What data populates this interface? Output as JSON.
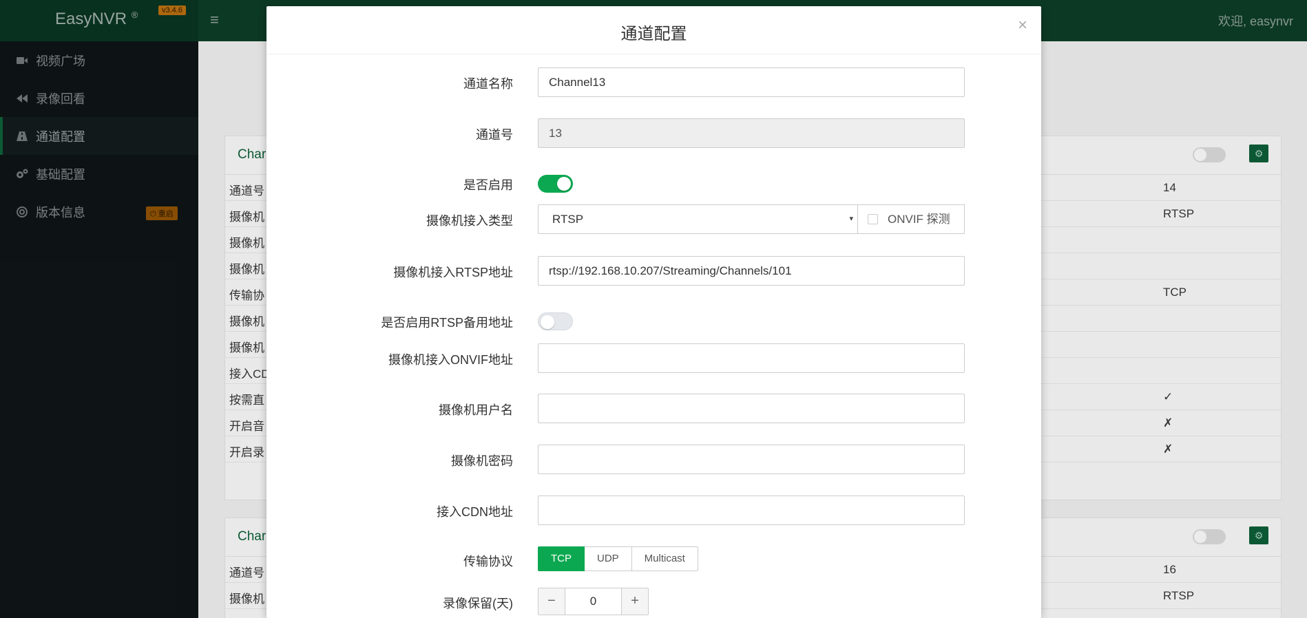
{
  "header": {
    "brand": "EasyNVR",
    "registered": "®",
    "version": "v3.4.6",
    "welcome": "欢迎, easynvr"
  },
  "sidebar": {
    "items": [
      {
        "label": "视频广场",
        "icon": "video-camera-icon"
      },
      {
        "label": "录像回看",
        "icon": "rewind-icon"
      },
      {
        "label": "通道配置",
        "icon": "road-icon",
        "active": true
      },
      {
        "label": "基础配置",
        "icon": "gears-icon"
      },
      {
        "label": "版本信息",
        "icon": "lifebuoy-icon",
        "badge": "⏻ 重启"
      }
    ]
  },
  "background": {
    "panels": [
      {
        "title": "Char",
        "rows": [
          {
            "label": "通道号",
            "value": "14"
          },
          {
            "label": "摄像机",
            "value": "RTSP"
          },
          {
            "label": "摄像机",
            "value": ""
          },
          {
            "label": "摄像机",
            "value": ""
          },
          {
            "label": "传输协",
            "value": "TCP"
          },
          {
            "label": "摄像机",
            "value": ""
          },
          {
            "label": "摄像机",
            "value": ""
          },
          {
            "label": "接入CD",
            "value": ""
          },
          {
            "label": "按需直",
            "value": "✓"
          },
          {
            "label": "开启音",
            "value": "✗"
          },
          {
            "label": "开启录",
            "value": "✗"
          }
        ]
      },
      {
        "title": "Char",
        "rows": [
          {
            "label": "通道号",
            "value": "16"
          },
          {
            "label": "摄像机",
            "value": "RTSP"
          }
        ]
      }
    ]
  },
  "modal": {
    "title": "通道配置",
    "close": "×",
    "fields": {
      "channel_name": {
        "label": "通道名称",
        "value": "Channel13"
      },
      "channel_no": {
        "label": "通道号",
        "value": "13"
      },
      "enabled": {
        "label": "是否启用",
        "on": true
      },
      "access_type": {
        "label": "摄像机接入类型",
        "value": "RTSP",
        "caret": "▾",
        "onvif_probe": "ONVIF 探测"
      },
      "rtsp_url": {
        "label": "摄像机接入RTSP地址",
        "value": "rtsp://192.168.10.207/Streaming/Channels/101"
      },
      "rtsp_backup": {
        "label": "是否启用RTSP备用地址",
        "on": false
      },
      "onvif_url": {
        "label": "摄像机接入ONVIF地址",
        "value": ""
      },
      "username": {
        "label": "摄像机用户名",
        "value": ""
      },
      "password": {
        "label": "摄像机密码",
        "value": ""
      },
      "cdn_url": {
        "label": "接入CDN地址",
        "value": ""
      },
      "protocol": {
        "label": "传输协议",
        "options": [
          "TCP",
          "UDP",
          "Multicast"
        ],
        "selected": "TCP"
      },
      "retention": {
        "label": "录像保留(天)",
        "value": "0",
        "minus": "−",
        "plus": "+"
      }
    }
  },
  "colors": {
    "accent": "#0ba851",
    "header_bg": "#0d3a25",
    "sidebar_bg": "#0e1416"
  }
}
